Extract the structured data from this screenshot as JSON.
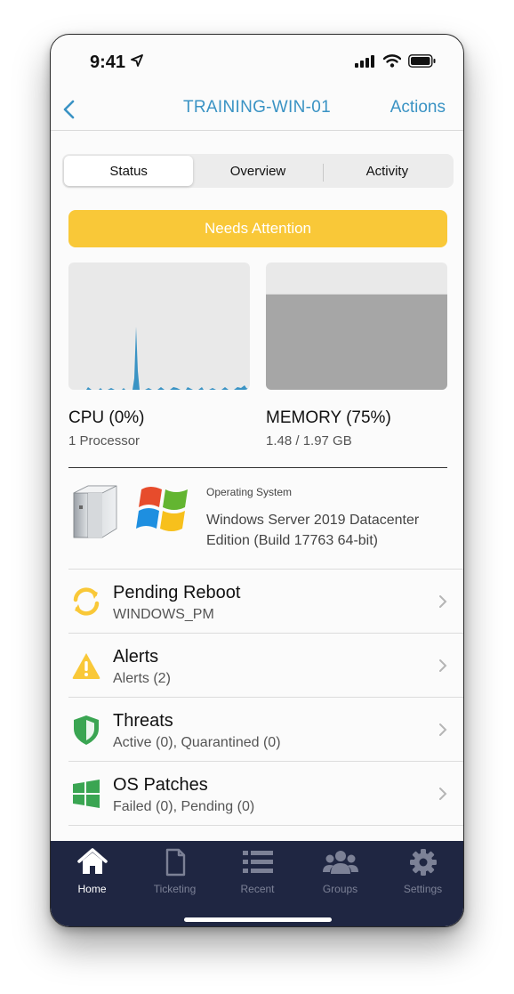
{
  "status_bar": {
    "time": "9:41"
  },
  "nav": {
    "title": "TRAINING-WIN-01",
    "actions_label": "Actions"
  },
  "segments": [
    {
      "label": "Status",
      "active": true
    },
    {
      "label": "Overview",
      "active": false
    },
    {
      "label": "Activity",
      "active": false
    }
  ],
  "banner": {
    "label": "Needs Attention",
    "color": "#f9c838"
  },
  "cpu": {
    "title": "CPU (0%)",
    "subtitle": "1 Processor",
    "percent": 0
  },
  "memory": {
    "title": "MEMORY (75%)",
    "subtitle": "1.48 / 1.97 GB",
    "percent": 75
  },
  "os": {
    "label": "Operating System",
    "value": "Windows Server 2019 Datacenter Edition (Build 17763 64-bit)"
  },
  "items": [
    {
      "icon": "refresh-icon",
      "title": "Pending Reboot",
      "subtitle": "WINDOWS_PM",
      "color": "#f9c838"
    },
    {
      "icon": "warning-icon",
      "title": "Alerts",
      "subtitle": "Alerts (2)",
      "color": "#f9c838"
    },
    {
      "icon": "shield-icon",
      "title": "Threats",
      "subtitle": "Active (0), Quarantined (0)",
      "color": "#3aa552"
    },
    {
      "icon": "windows-icon",
      "title": "OS Patches",
      "subtitle": "Failed (0), Pending (0)",
      "color": "#3aa552"
    }
  ],
  "tabs": [
    {
      "label": "Home",
      "icon": "home-icon",
      "active": true
    },
    {
      "label": "Ticketing",
      "icon": "document-icon",
      "active": false
    },
    {
      "label": "Recent",
      "icon": "list-icon",
      "active": false
    },
    {
      "label": "Groups",
      "icon": "group-icon",
      "active": false
    },
    {
      "label": "Settings",
      "icon": "gear-icon",
      "active": false
    }
  ],
  "colors": {
    "accent": "#3a93c4",
    "tabbar": "#1f2642",
    "graph_line": "#3a93c4"
  }
}
